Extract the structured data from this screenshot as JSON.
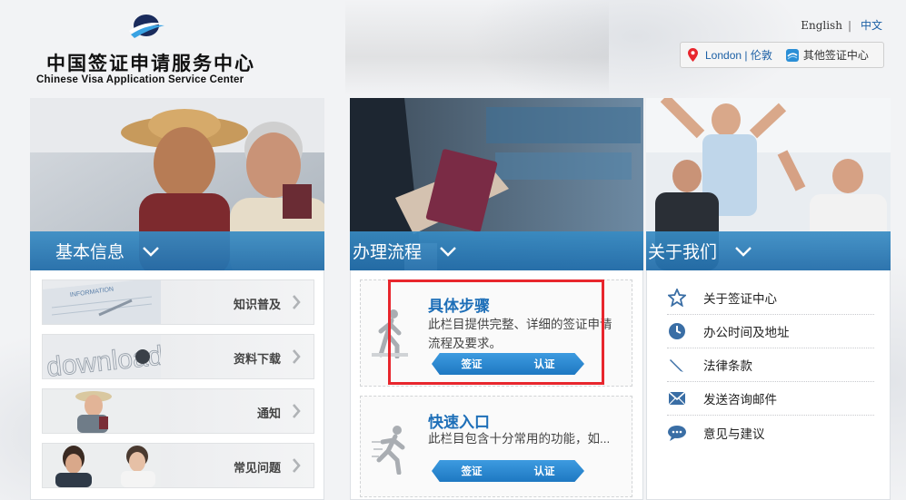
{
  "header": {
    "logo_cn": "中国签证申请服务中心",
    "logo_en": "Chinese Visa Application Service Center",
    "lang_en": "English",
    "lang_sep": "|",
    "lang_zh": "中文",
    "location": "London | 伦敦",
    "other_centers": "其他签证中心"
  },
  "col1": {
    "title": "基本信息",
    "items": [
      {
        "label": "知识普及"
      },
      {
        "label": "资料下载"
      },
      {
        "label": "通知"
      },
      {
        "label": "常见问题"
      }
    ]
  },
  "col2": {
    "title": "办理流程",
    "cards": [
      {
        "title": "具体步骤",
        "desc": "此栏目提供完整、详细的签证申请流程及要求。",
        "btn_visa": "签证",
        "btn_auth": "认证"
      },
      {
        "title": "快速入口",
        "desc": "此栏目包含十分常用的功能，如...",
        "btn_visa": "签证",
        "btn_auth": "认证"
      }
    ]
  },
  "col3": {
    "title": "关于我们",
    "items": [
      {
        "label": "关于签证中心",
        "icon": "star-icon"
      },
      {
        "label": "办公时间及地址",
        "icon": "clock-icon"
      },
      {
        "label": "法律条款",
        "icon": "pen-icon"
      },
      {
        "label": "发送咨询邮件",
        "icon": "envelope-icon"
      },
      {
        "label": "意见与建议",
        "icon": "chat-bubble-icon"
      }
    ]
  },
  "thumb_text": {
    "download": "download",
    "information": "INFORMATION"
  },
  "colors": {
    "accent_blue": "#1e6fb8",
    "bar_blue": "#2e86c2",
    "highlight_red": "#e8262d"
  }
}
